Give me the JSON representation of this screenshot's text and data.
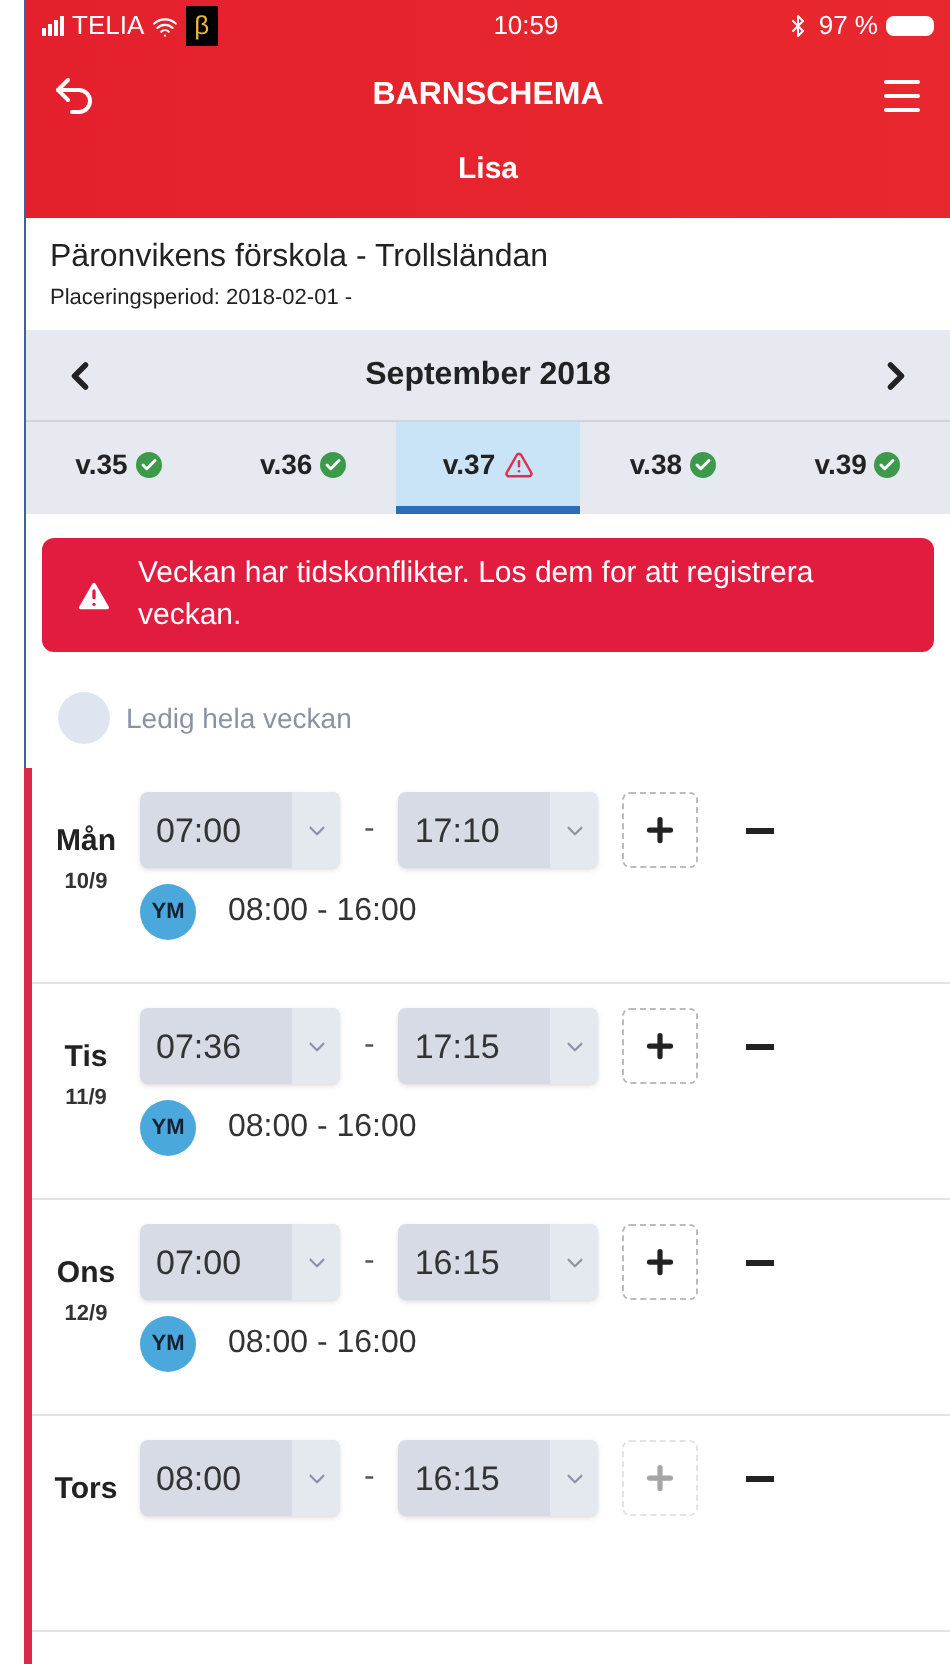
{
  "status_bar": {
    "carrier": "TELIA",
    "beta": "β",
    "time": "10:59",
    "battery": "97 %"
  },
  "header": {
    "title": "BARNSCHEMA",
    "child": "Lisa"
  },
  "placement": {
    "name": "Päronvikens förskola - Trollsländan",
    "period": "Placeringsperiod: 2018-02-01 -"
  },
  "month": {
    "label": "September 2018"
  },
  "weeks": [
    {
      "label": "v.35",
      "kind": "ok",
      "selected": false
    },
    {
      "label": "v.36",
      "kind": "ok",
      "selected": false
    },
    {
      "label": "v.37",
      "kind": "conflict",
      "selected": true
    },
    {
      "label": "v.38",
      "kind": "ok",
      "selected": false
    },
    {
      "label": "v.39",
      "kind": "ok",
      "selected": false
    }
  ],
  "alert": {
    "text": "Veckan har tidskonflikter. Los dem for att registrera veckan."
  },
  "free_week": {
    "label": "Ledig hela veckan",
    "disabled": true
  },
  "days": [
    {
      "day": "Mån",
      "date": "10/9",
      "start": "07:00",
      "separator": "-",
      "end": "17:10",
      "add_disabled": false,
      "other": {
        "initials": "YM",
        "time": "08:00 - 16:00"
      }
    },
    {
      "day": "Tis",
      "date": "11/9",
      "start": "07:36",
      "separator": "-",
      "end": "17:15",
      "add_disabled": false,
      "other": {
        "initials": "YM",
        "time": "08:00 - 16:00"
      }
    },
    {
      "day": "Ons",
      "date": "12/9",
      "start": "07:00",
      "separator": "-",
      "end": "16:15",
      "add_disabled": false,
      "other": {
        "initials": "YM",
        "time": "08:00 - 16:00"
      }
    },
    {
      "day": "Tors",
      "start": "08:00",
      "separator": "-",
      "end": "16:15",
      "add_disabled": true
    }
  ]
}
